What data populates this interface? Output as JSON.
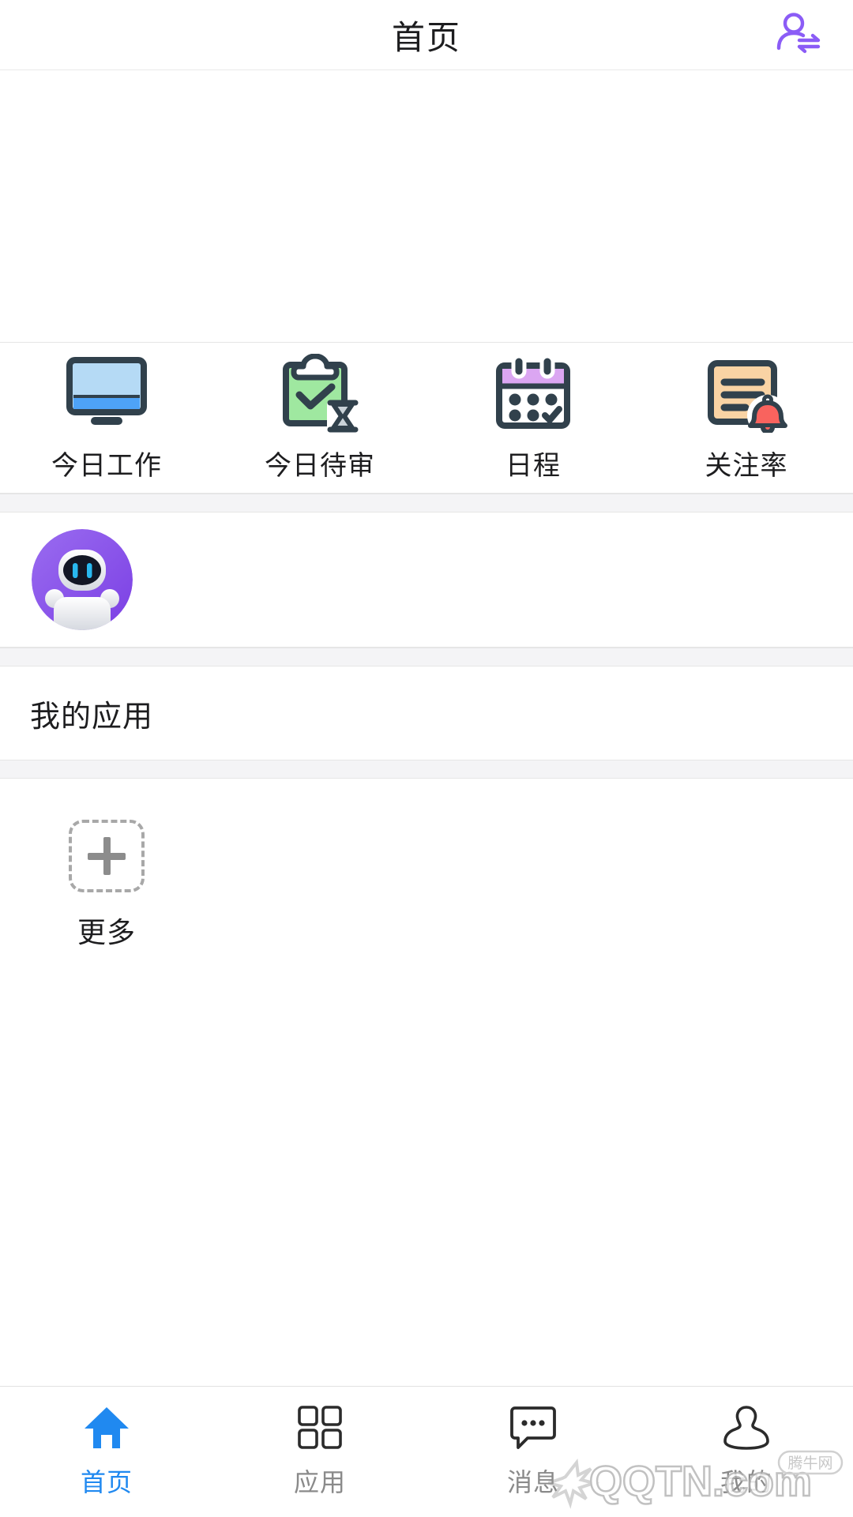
{
  "header": {
    "title": "首页",
    "action_icon": "switch-user-icon",
    "action_color": "#8b5cf6"
  },
  "banner": {
    "content": ""
  },
  "quick_actions": {
    "items": [
      {
        "label": "今日工作",
        "icon": "monitor-icon",
        "color": "#a9d4f2"
      },
      {
        "label": "今日待审",
        "icon": "clipboard-check-hourglass-icon",
        "color": "#9fe8a0"
      },
      {
        "label": "日程",
        "icon": "calendar-icon",
        "color": "#dba6f2"
      },
      {
        "label": "关注率",
        "icon": "document-bell-icon",
        "color": "#f9d3a4"
      }
    ]
  },
  "assistant": {
    "avatar_icon": "robot-assistant-avatar",
    "avatar_bg": "#8450e8"
  },
  "my_apps": {
    "title": "我的应用",
    "items": [
      {
        "label": "更多",
        "icon": "add-plus-icon"
      }
    ]
  },
  "tabbar": {
    "items": [
      {
        "label": "首页",
        "icon": "home-icon",
        "active": true
      },
      {
        "label": "应用",
        "icon": "grid-icon",
        "active": false
      },
      {
        "label": "消息",
        "icon": "chat-icon",
        "active": false
      },
      {
        "label": "我的",
        "icon": "person-icon",
        "active": false
      }
    ],
    "active_color": "#2089f0",
    "inactive_color": "#4a4a4a"
  },
  "watermark": {
    "text": "QQTN.com",
    "badge": "腾牛网"
  }
}
